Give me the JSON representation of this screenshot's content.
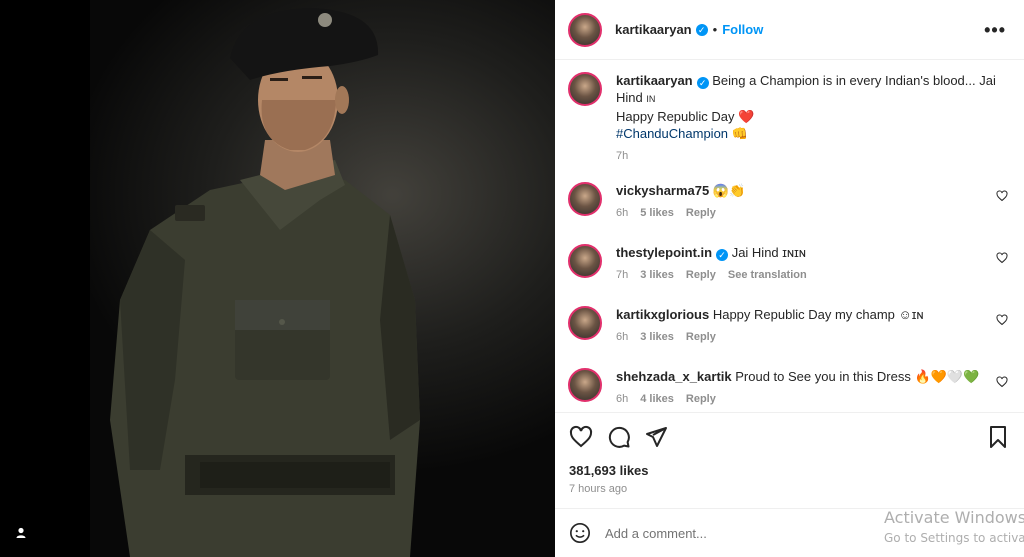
{
  "post": {
    "author": "kartikaaryan",
    "follow_label": "Follow",
    "more_label": "•••",
    "caption_line1": "Being a Champion is in every Indian's blood... Jai Hind",
    "caption_flag": "IN",
    "caption_line2": "Happy Republic Day",
    "caption_heart": "❤️",
    "caption_hashtag": "#ChanduChampion",
    "caption_emoji": "👊",
    "caption_time": "7h",
    "likes": "381,693 likes",
    "time_ago": "7 hours ago"
  },
  "comments": [
    {
      "user": "vickysharma75",
      "text": "😱👏",
      "verified": false,
      "time": "6h",
      "likes": "5 likes",
      "reply": "Reply",
      "extra": ""
    },
    {
      "user": "thestylepoint.in",
      "text": "Jai Hind ɪɴɪɴ",
      "verified": true,
      "time": "7h",
      "likes": "3 likes",
      "reply": "Reply",
      "extra": "See translation"
    },
    {
      "user": "kartikxglorious",
      "text": "Happy Republic Day my champ ☺ɪɴ",
      "verified": false,
      "time": "6h",
      "likes": "3 likes",
      "reply": "Reply",
      "extra": ""
    },
    {
      "user": "shehzada_x_kartik",
      "text": "Proud to See you in this Dress 🔥🧡🤍💚",
      "verified": false,
      "time": "6h",
      "likes": "4 likes",
      "reply": "Reply",
      "extra": ""
    }
  ],
  "input": {
    "placeholder": "Add a comment..."
  },
  "watermark": {
    "line1": "Activate Windows",
    "line2": "Go to Settings to activate Windows."
  },
  "icons": [
    "heart-icon",
    "comment-icon",
    "share-icon",
    "bookmark-icon",
    "emoji-icon",
    "verified-icon",
    "user-icon"
  ],
  "colors": {
    "accent": "#0095f6",
    "text": "#262626",
    "muted": "#8e8e8e",
    "hashtag": "#00376b",
    "heart": "#ed4956"
  }
}
